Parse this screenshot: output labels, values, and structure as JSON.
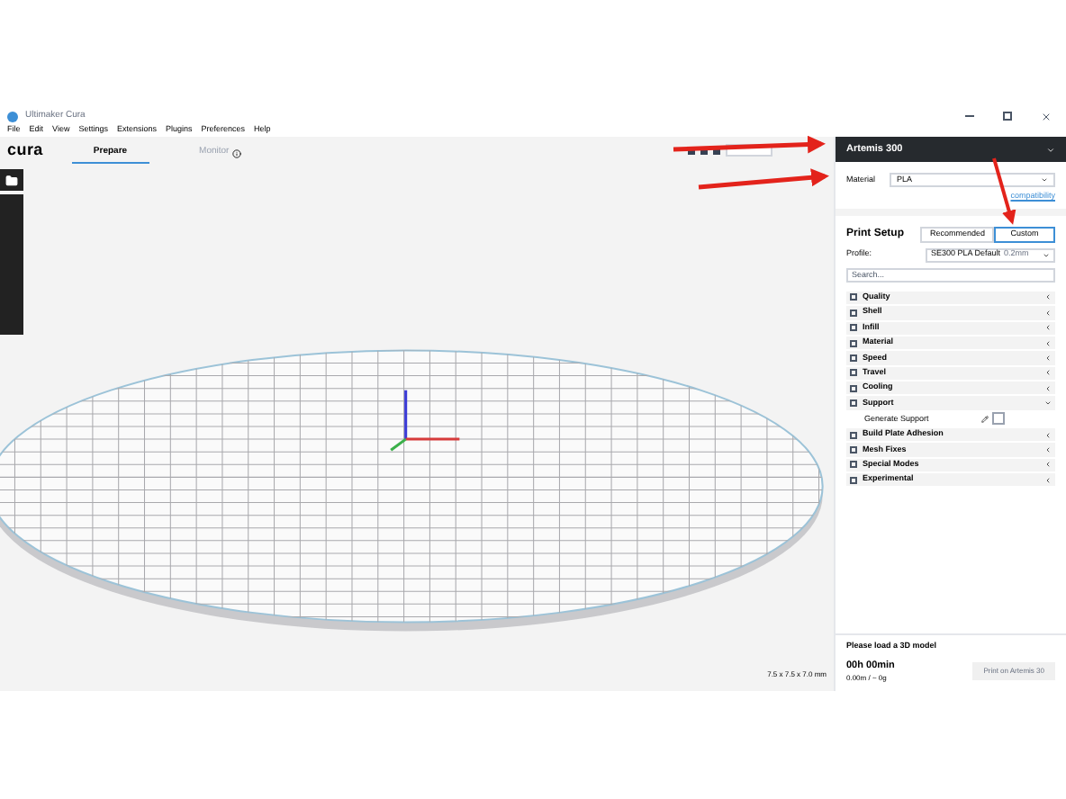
{
  "window": {
    "title": "Ultimaker Cura"
  },
  "menu": [
    "File",
    "Edit",
    "View",
    "Settings",
    "Extensions",
    "Plugins",
    "Preferences",
    "Help"
  ],
  "header": {
    "logo": "cura",
    "tabs": [
      {
        "label": "Prepare",
        "selected": true
      },
      {
        "label": "Monitor",
        "selected": false
      }
    ]
  },
  "viewport": {
    "dimensions": "7.5 x 7.5 x 7.0 mm"
  },
  "printer": {
    "name": "Artemis 300",
    "material_label": "Material",
    "material": "PLA",
    "link": "compatibility"
  },
  "print_setup": {
    "title": "Print Setup",
    "modes": [
      {
        "label": "Recommended",
        "selected": false
      },
      {
        "label": "Custom",
        "selected": true
      }
    ],
    "profile_label": "Profile:",
    "profile": "SE300 PLA Default",
    "profile_note": "0.2mm",
    "search_placeholder": "Search..."
  },
  "categories": [
    {
      "label": "Quality",
      "expanded": false
    },
    {
      "label": "Shell",
      "expanded": false
    },
    {
      "label": "Infill",
      "expanded": false
    },
    {
      "label": "Material",
      "expanded": false
    },
    {
      "label": "Speed",
      "expanded": false
    },
    {
      "label": "Travel",
      "expanded": false
    },
    {
      "label": "Cooling",
      "expanded": false
    },
    {
      "label": "Support",
      "expanded": true,
      "children": [
        {
          "label": "Generate Support",
          "checked": false
        }
      ]
    },
    {
      "label": "Build Plate Adhesion",
      "expanded": false
    },
    {
      "label": "Mesh Fixes",
      "expanded": false
    },
    {
      "label": "Special Modes",
      "expanded": false
    },
    {
      "label": "Experimental",
      "expanded": false
    }
  ],
  "footer": {
    "message": "Please load a 3D model",
    "time": "00h 00min",
    "usage": "0.00m / ~ 0g",
    "button": "Print on Artemis 30"
  }
}
